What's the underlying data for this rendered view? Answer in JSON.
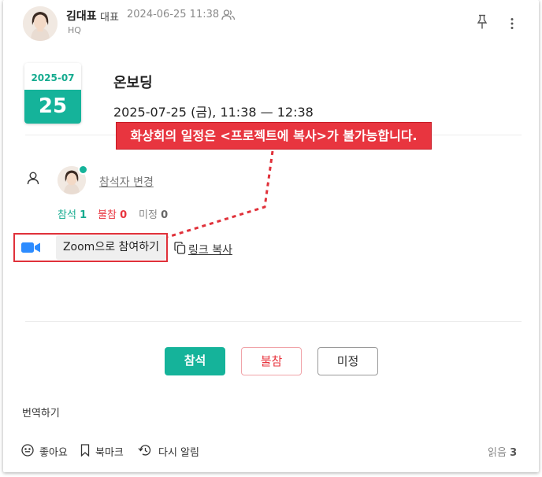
{
  "author": {
    "name": "김대표",
    "role": "대표",
    "date": "2024-06-25 11:38",
    "department": "HQ"
  },
  "calendar": {
    "month": "2025-07",
    "day": "25"
  },
  "event": {
    "title": "온보딩",
    "time": "2025-07-25 (금), 11:38 — 12:38"
  },
  "annotation": {
    "text": "화상회의 일정은 <프로젝트에 복사>가 불가능합니다."
  },
  "attendees": {
    "change_label": "참석자 변경",
    "attend_label": "참석",
    "attend_count": "1",
    "decline_label": "불참",
    "decline_count": "0",
    "undecided_label": "미정",
    "undecided_count": "0"
  },
  "meeting": {
    "join_label": "Zoom으로 참여하기",
    "copy_link_label": "링크 복사"
  },
  "rsvp": {
    "attend": "참석",
    "decline": "불참",
    "undecided": "미정"
  },
  "translate_label": "번역하기",
  "footer": {
    "like": "좋아요",
    "bookmark": "북마크",
    "remind": "다시 알림",
    "read_label": "읽음",
    "read_count": "3"
  },
  "colors": {
    "accent": "#15b39a",
    "decline": "#e8353f",
    "zoom_blue": "#2d8cff",
    "annotation_red": "#e8353f"
  },
  "icons": {
    "visibility": "people-icon",
    "pin": "pin-icon",
    "more": "more-vertical-icon",
    "attendee": "person-icon",
    "video": "video-camera-icon",
    "copy": "copy-icon",
    "like": "smile-icon",
    "bookmark": "bookmark-icon",
    "remind": "remind-icon"
  }
}
